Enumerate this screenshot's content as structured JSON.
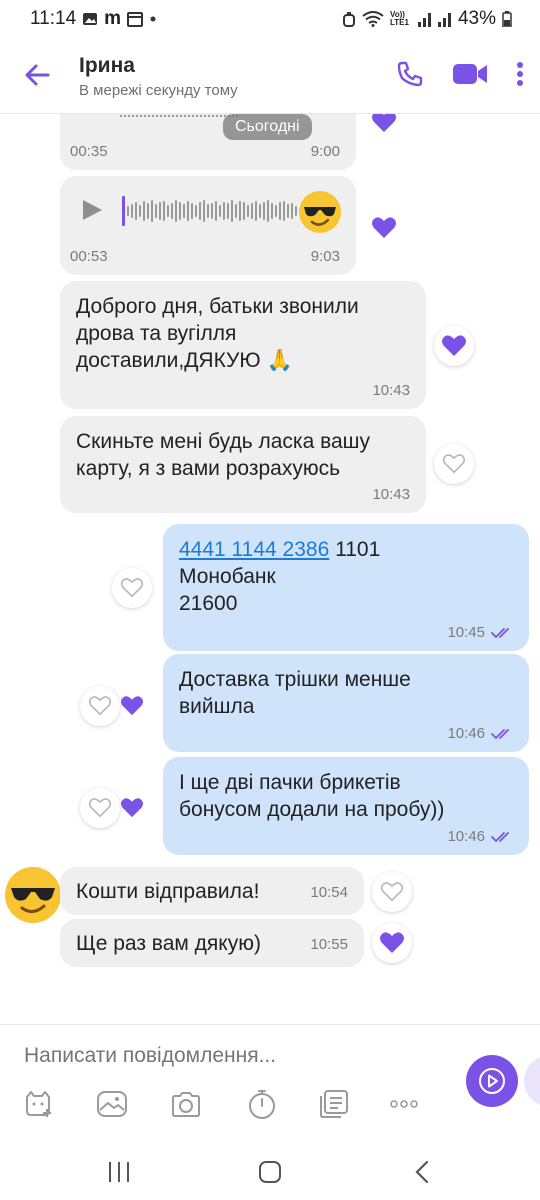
{
  "status_bar": {
    "time": "11:14",
    "carrier_text": "m",
    "network_label": "Vo)) LTE1",
    "battery": "43%"
  },
  "header": {
    "contact_name": "Ірина",
    "contact_status": "В мережі секунду тому",
    "icons": [
      "back-arrow-icon",
      "phone-icon",
      "video-icon",
      "more-vert-icon"
    ]
  },
  "chat": {
    "date_chip": "Сьогодні",
    "messages": [
      {
        "type": "voice",
        "direction": "incoming",
        "duration": "00:35",
        "time": "9:00",
        "reaction": "liked"
      },
      {
        "type": "voice",
        "direction": "incoming",
        "duration": "00:53",
        "time": "9:03",
        "reaction": "liked"
      },
      {
        "type": "text",
        "direction": "incoming",
        "lines": [
          "Доброго дня, батьки звонили",
          "дрова та вугілля",
          "доставили,ДЯКУЮ 🙏"
        ],
        "time": "10:43",
        "reaction": "liked"
      },
      {
        "type": "text",
        "direction": "incoming",
        "lines": [
          "Скиньте мені будь ласка вашу",
          "карту, я з вами розрахуюсь"
        ],
        "time": "10:43",
        "reaction": "none"
      },
      {
        "type": "text",
        "direction": "outgoing",
        "link": "4441 1144 2386",
        "link_rest": " 1101",
        "lines": [
          "Монобанк",
          "21600"
        ],
        "time": "10:45",
        "status": "read",
        "reaction": "none"
      },
      {
        "type": "text",
        "direction": "outgoing",
        "lines": [
          "Доставка трішки менше",
          "вийшла"
        ],
        "time": "10:46",
        "status": "read",
        "reaction": "liked"
      },
      {
        "type": "text",
        "direction": "outgoing",
        "lines": [
          "І ще дві пачки брикетів",
          "бонусом додали на пробу))"
        ],
        "time": "10:46",
        "status": "read",
        "reaction": "liked"
      },
      {
        "type": "text",
        "direction": "incoming",
        "lines": [
          "Кошти відправила!"
        ],
        "time": "10:54",
        "reaction": "none"
      },
      {
        "type": "text",
        "direction": "incoming",
        "lines": [
          "Ще раз вам дякую)"
        ],
        "time": "10:55",
        "reaction": "liked"
      }
    ]
  },
  "composer": {
    "placeholder": "Написати повідомлення...",
    "tools": [
      "sticker-icon",
      "gallery-icon",
      "camera-icon",
      "timer-icon",
      "notes-icon",
      "more-horiz-icon"
    ]
  },
  "colors": {
    "accent": "#7b52e6",
    "incoming_bubble": "#efefef",
    "outgoing_bubble": "#cfe4fa",
    "link": "#1a7bd8"
  }
}
